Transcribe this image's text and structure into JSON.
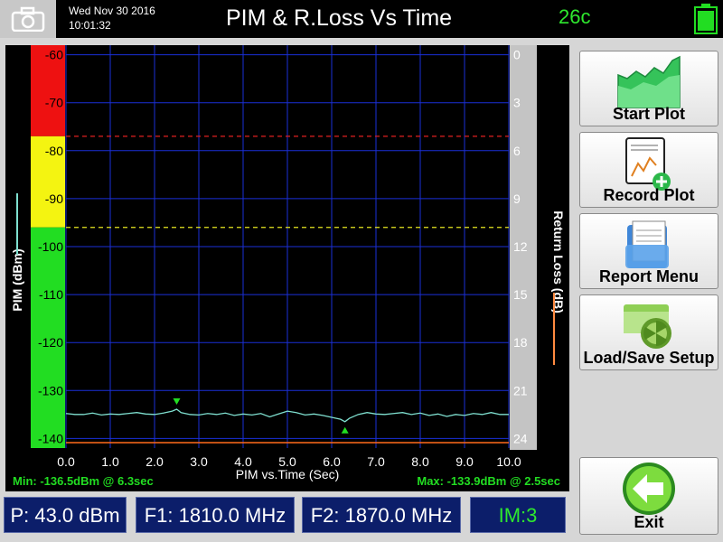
{
  "header": {
    "date": "Wed Nov 30 2016",
    "time": "10:01:32",
    "title": "PIM & R.Loss Vs Time",
    "temperature": "26c",
    "camera_icon": "camera-icon",
    "battery_icon": "battery-icon",
    "battery_color": "#22dd22"
  },
  "buttons": {
    "start_plot": "Start Plot",
    "record_plot": "Record Plot",
    "report_menu": "Report Menu",
    "load_save_setup": "Load/Save Setup",
    "exit": "Exit"
  },
  "status": {
    "power": "P: 43.0 dBm",
    "f1": "F1: 1810.0 MHz",
    "f2": "F2: 1870.0 MHz",
    "im": "IM:3"
  },
  "chart_data": {
    "type": "line",
    "xlabel": "PIM vs.Time (Sec)",
    "ylabel_left": "PIM (dBm)",
    "ylabel_right": "Return Loss (dB)",
    "xlim": [
      0,
      10
    ],
    "ylim_left": [
      -142,
      -58
    ],
    "ylim_right": [
      0,
      24
    ],
    "x_ticks": [
      "0.0",
      "1.0",
      "2.0",
      "3.0",
      "4.0",
      "5.0",
      "6.0",
      "7.0",
      "8.0",
      "9.0",
      "10.0"
    ],
    "y_ticks_left": [
      "-60",
      "-70",
      "-80",
      "-90",
      "-100",
      "-110",
      "-120",
      "-130",
      "-140"
    ],
    "y_ticks_right": [
      "0",
      "3",
      "6",
      "9",
      "12",
      "15",
      "18",
      "21",
      "24"
    ],
    "grid": true,
    "threshold_red_dbm": -77,
    "threshold_yellow_dbm": -96,
    "band_colors": {
      "red": "#ee1111",
      "yellow": "#f4f411",
      "green": "#22dd22"
    },
    "series": [
      {
        "color": "#7fe0d0",
        "x": [
          0.0,
          0.2,
          0.4,
          0.6,
          0.8,
          1.0,
          1.2,
          1.4,
          1.6,
          1.8,
          2.0,
          2.2,
          2.4,
          2.5,
          2.6,
          2.8,
          3.0,
          3.2,
          3.4,
          3.6,
          3.8,
          4.0,
          4.2,
          4.4,
          4.6,
          4.8,
          5.0,
          5.2,
          5.4,
          5.6,
          5.8,
          6.0,
          6.2,
          6.3,
          6.4,
          6.6,
          6.8,
          7.0,
          7.2,
          7.4,
          7.6,
          7.8,
          8.0,
          8.2,
          8.4,
          8.6,
          8.8,
          9.0,
          9.2,
          9.4,
          9.6,
          9.8,
          10.0
        ],
        "y": [
          -134.8,
          -135.0,
          -135.0,
          -134.7,
          -135.1,
          -134.9,
          -135.0,
          -134.8,
          -134.6,
          -134.9,
          -135.0,
          -134.7,
          -134.3,
          -133.9,
          -134.6,
          -135.0,
          -135.1,
          -134.8,
          -135.0,
          -134.7,
          -135.2,
          -134.9,
          -135.1,
          -134.8,
          -135.5,
          -134.9,
          -134.3,
          -134.6,
          -135.1,
          -134.9,
          -135.2,
          -135.6,
          -136.0,
          -136.5,
          -135.8,
          -135.0,
          -134.6,
          -134.9,
          -135.0,
          -134.8,
          -134.6,
          -135.0,
          -134.7,
          -135.2,
          -134.9,
          -135.4,
          -135.0,
          -135.2,
          -134.8,
          -135.0,
          -134.6,
          -135.0,
          -135.0
        ]
      }
    ],
    "min_marker": {
      "x": 6.3,
      "y": -136.5
    },
    "max_marker": {
      "x": 2.5,
      "y": -133.9
    },
    "min_label": "Min: -136.5dBm @ 6.3sec",
    "max_label": "Max: -133.9dBm @ 2.5sec"
  }
}
